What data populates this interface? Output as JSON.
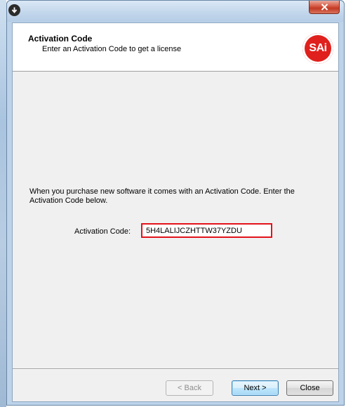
{
  "header": {
    "title": "Activation Code",
    "subtitle": "Enter an Activation Code to get a license",
    "logo_text": "SAi"
  },
  "body": {
    "instruction": "When you purchase new software it comes with an Activation Code.  Enter the Activation Code below.",
    "code_label": "Activation Code:",
    "code_value": "5H4LALIJCZHTTW37YZDU"
  },
  "buttons": {
    "back": "< Back",
    "next": "Next >",
    "close": "Close"
  },
  "colors": {
    "highlight_border": "#e2131a",
    "logo_red": "#e0201c",
    "client_bg": "#f0f0f0"
  },
  "icons": {
    "app_icon": "download-circle-icon",
    "close_icon": "close-x-icon"
  }
}
